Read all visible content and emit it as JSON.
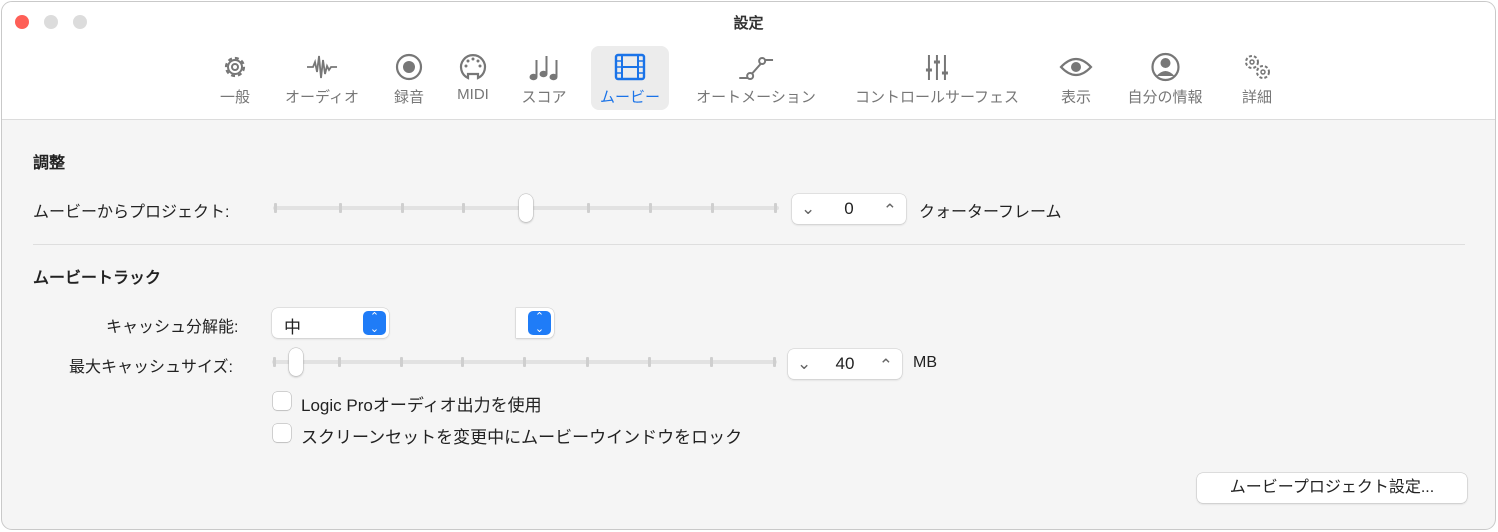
{
  "window": {
    "title": "設定"
  },
  "toolbar": [
    {
      "label": "一般",
      "icon": "gear-icon"
    },
    {
      "label": "オーディオ",
      "icon": "waveform-icon"
    },
    {
      "label": "録音",
      "icon": "record-icon"
    },
    {
      "label": "MIDI",
      "icon": "midi-connector-icon"
    },
    {
      "label": "スコア",
      "icon": "music-notes-icon"
    },
    {
      "label": "ムービー",
      "icon": "film-icon",
      "selected": true
    },
    {
      "label": "オートメーション",
      "icon": "automation-icon"
    },
    {
      "label": "コントロールサーフェス",
      "icon": "sliders-icon"
    },
    {
      "label": "表示",
      "icon": "eye-icon"
    },
    {
      "label": "自分の情報",
      "icon": "person-icon"
    },
    {
      "label": "詳細",
      "icon": "gears-icon"
    }
  ],
  "colors": {
    "accent": "#1f7cf7",
    "close": "#fe5f57",
    "disabled": "#dcdcdc"
  },
  "adjust": {
    "heading": "調整",
    "offset_label": "ムービーからプロジェクト:",
    "offset_slider_fraction": 0.5,
    "offset_value": "0",
    "offset_unit": "クォーターフレーム"
  },
  "movie_track": {
    "heading": "ムービートラック",
    "cache_res_label": "キャッシュ分解能:",
    "cache_res_value": "中",
    "cache_size_label": "最大キャッシュサイズ:",
    "cache_size_slider_fraction": 0.045,
    "cache_size_value": "40",
    "cache_size_unit": "MB",
    "checkbox1": "Logic Proオーディオ出力を使用",
    "checkbox2": "スクリーンセットを変更中にムービーウインドウをロック"
  },
  "project_settings_button": "ムービープロジェクト設定..."
}
